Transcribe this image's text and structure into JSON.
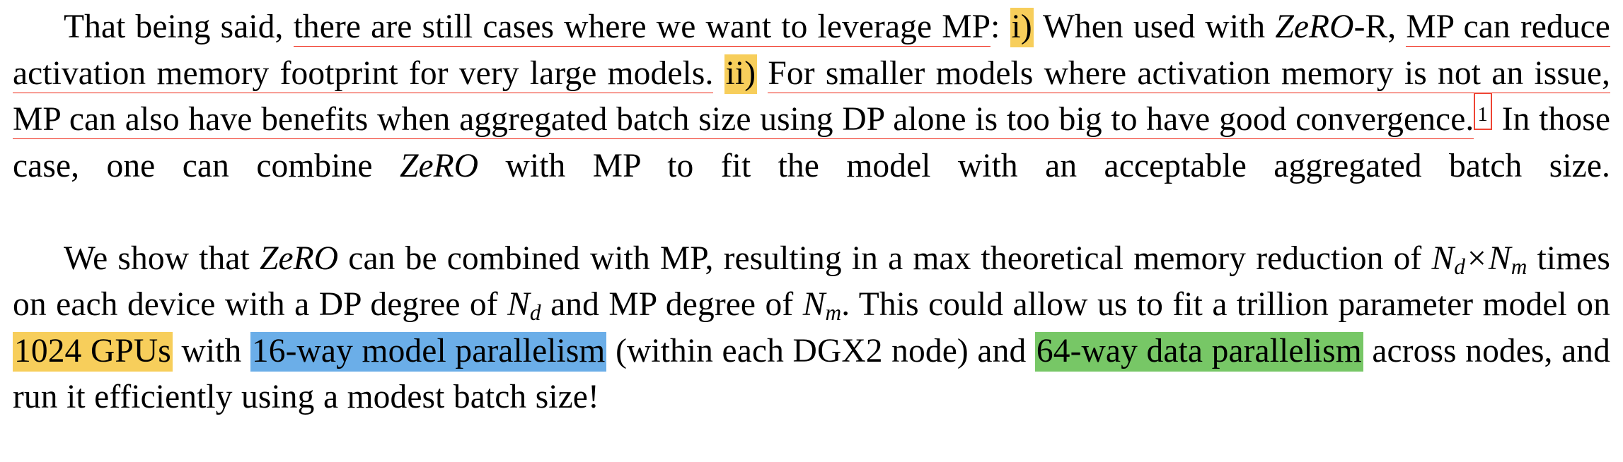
{
  "document": {
    "type": "academic-paper-excerpt",
    "colors": {
      "underline_red": "#ee2211",
      "highlight_amber": "#f7ce5b",
      "highlight_blue": "#6baee8",
      "highlight_green": "#77c766",
      "footnote_box_border": "#ee4433",
      "text": "#000000",
      "background": "#ffffff"
    }
  },
  "paragraph1": {
    "seg1": "That being said, ",
    "seg2_underlined": "there are still cases where we want to leverage MP",
    "seg3": ":",
    "seg4_highlight_amber": "i)",
    "seg5": " When used with ",
    "seg6_italic": "ZeRO",
    "seg7": "-R, ",
    "seg8_underlined": "MP can reduce activation memory footprint for very large models.",
    "seg9_highlight_amber": "ii)",
    "seg10_underlined": "For smaller models where activation memory is not an issue, MP can also have benefits when aggregated batch size using DP alone is too big to have good convergence.",
    "seg11_footnote_boxed": "1",
    "seg12": " In those case, one can combine ",
    "seg13_italic": "ZeRO",
    "seg14": " with MP to fit the model with an acceptable aggregated batch size."
  },
  "paragraph2": {
    "seg1": "We show that ",
    "seg2_italic": "ZeRO",
    "seg3": " can be combined with MP, resulting in a max theoretical memory reduction of ",
    "math1": {
      "base": "N",
      "sub": "d"
    },
    "times": "×",
    "math2": {
      "base": "N",
      "sub": "m"
    },
    "seg4": " times on each device with a DP degree of ",
    "math3": {
      "base": "N",
      "sub": "d"
    },
    "seg5": " and MP degree of ",
    "math4": {
      "base": "N",
      "sub": "m"
    },
    "seg6": ". This could allow us to fit a trillion parameter model on ",
    "seg7_highlight_amber": "1024 GPUs",
    "seg8": " with ",
    "seg9_highlight_blue": "16-way model parallelism",
    "seg10": " (within each DGX2 node) and ",
    "seg11_highlight_green": "64-way data parallelism",
    "seg12": " across nodes, and run it efficiently using a modest batch size!"
  }
}
